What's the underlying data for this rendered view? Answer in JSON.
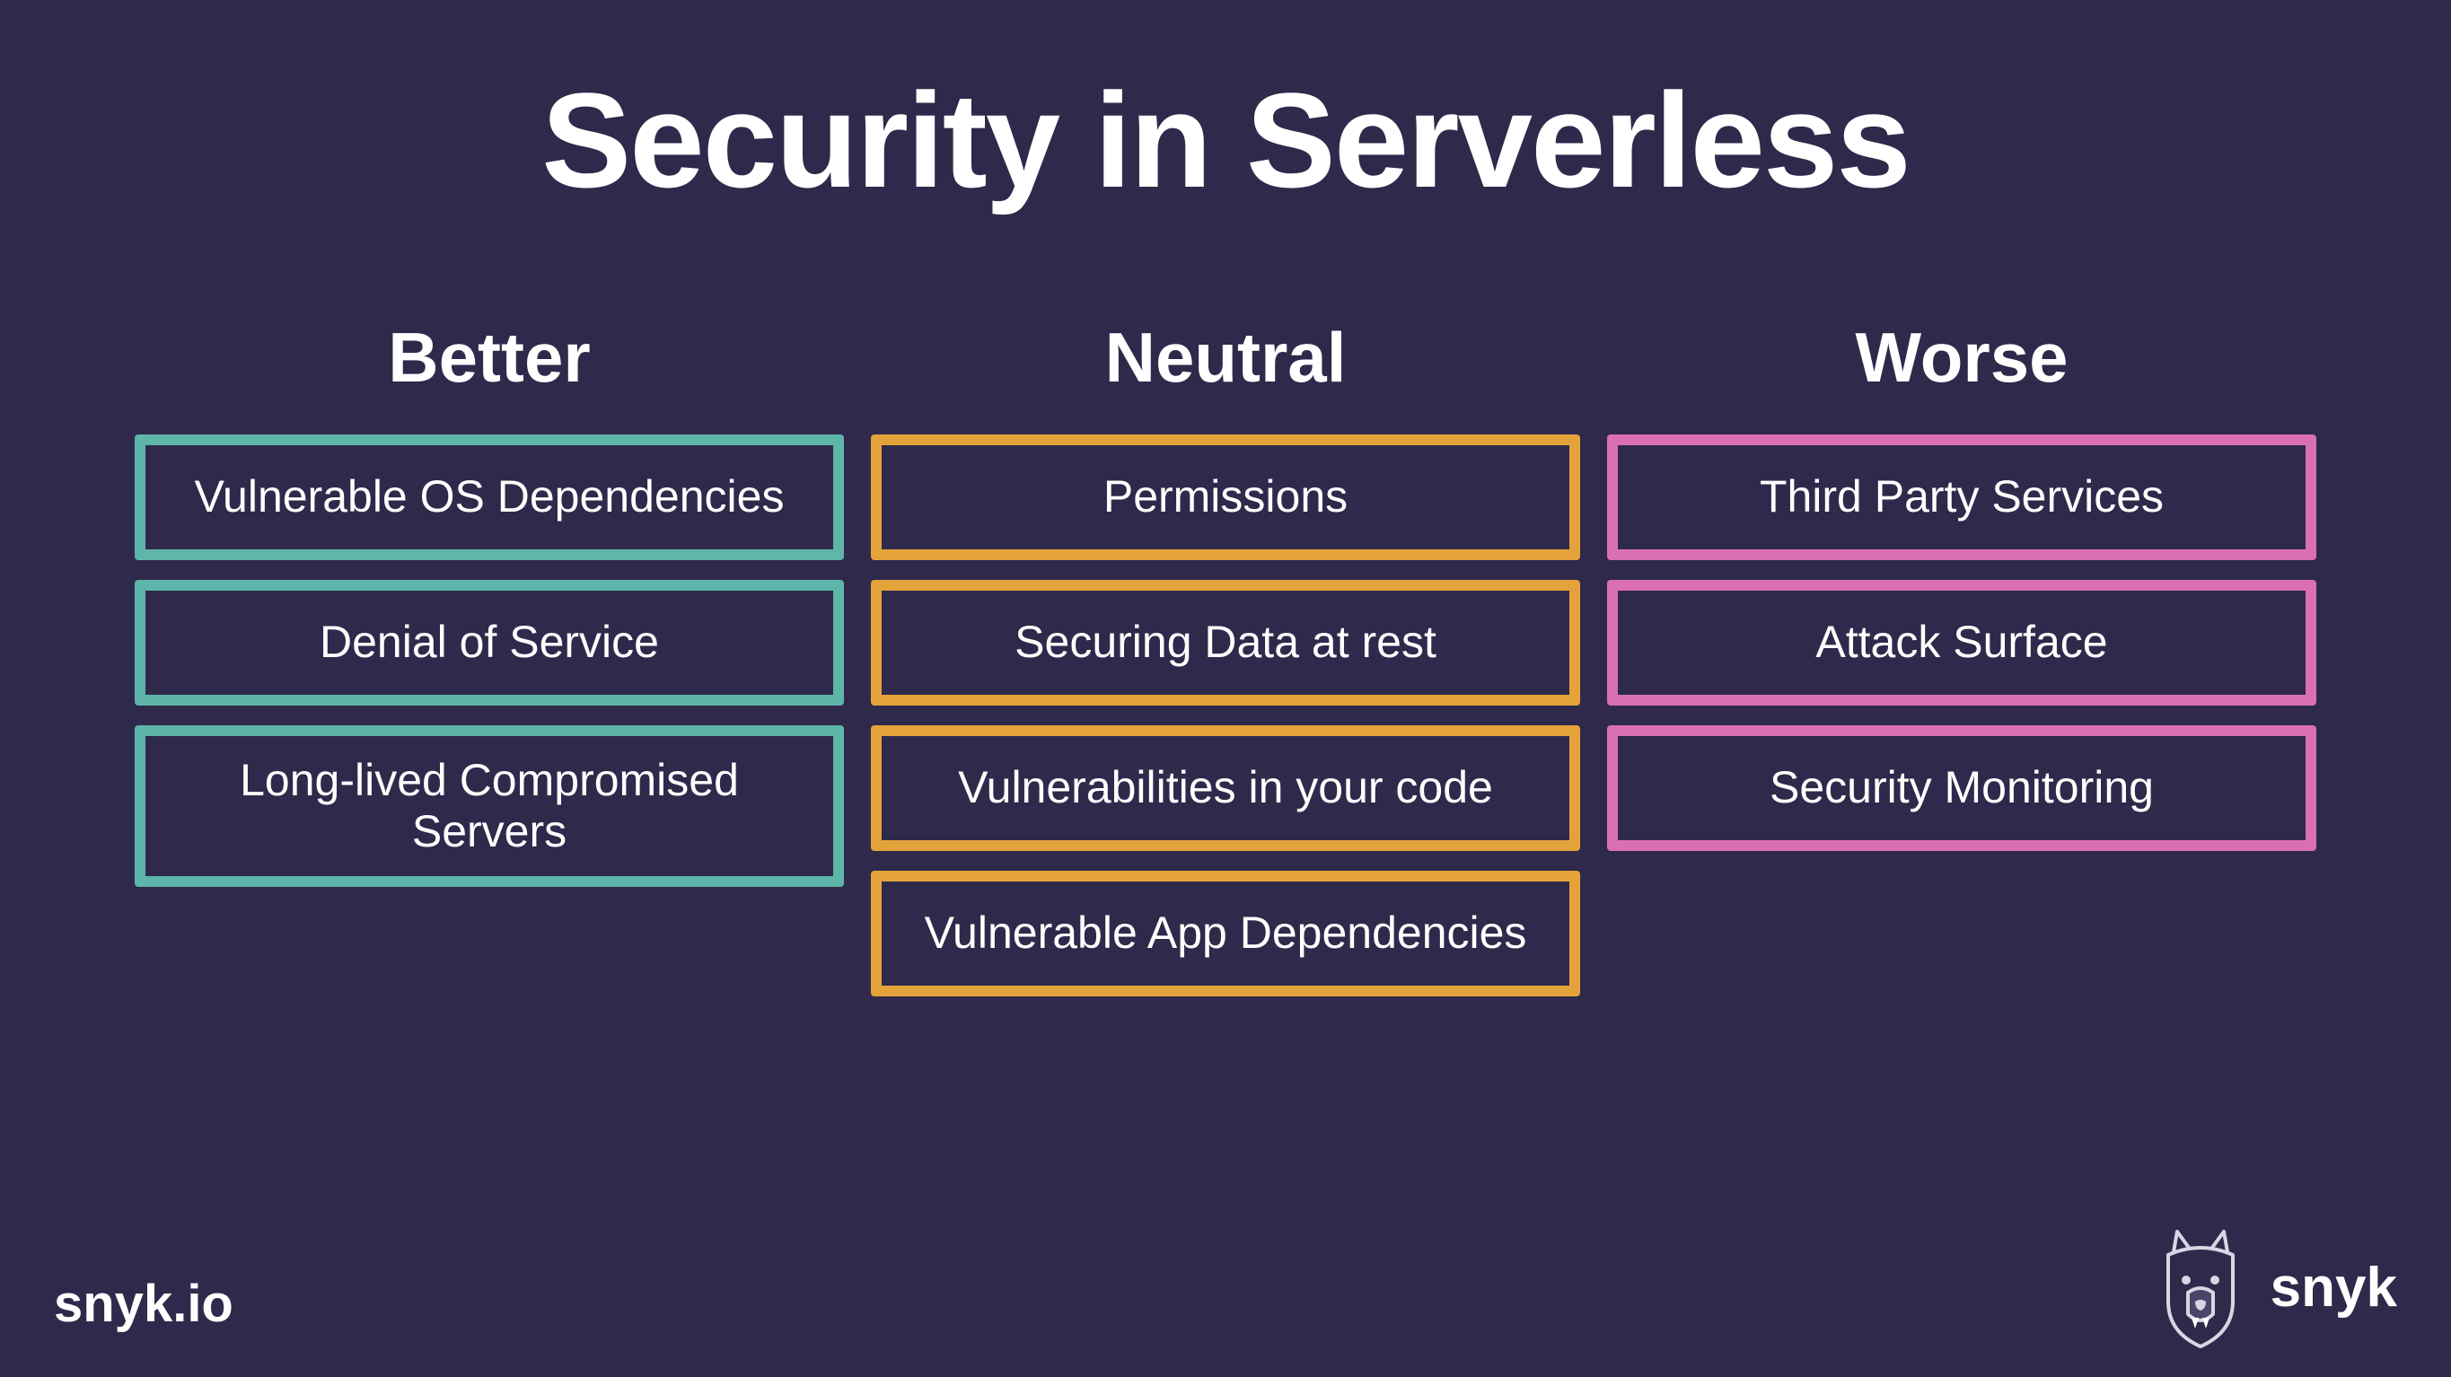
{
  "title": "Security in Serverless",
  "columns": {
    "better": {
      "heading": "Better",
      "color": "teal",
      "items": [
        "Vulnerable OS Dependencies",
        "Denial of Service",
        "Long-lived Compromised Servers"
      ]
    },
    "neutral": {
      "heading": "Neutral",
      "color": "orange",
      "items": [
        "Permissions",
        "Securing Data at rest",
        "Vulnerabilities in your code",
        "Vulnerable App Dependencies"
      ]
    },
    "worse": {
      "heading": "Worse",
      "color": "pink",
      "items": [
        "Third Party Services",
        "Attack Surface",
        "Security Monitoring"
      ]
    }
  },
  "footer": {
    "site": "snyk.io",
    "brand": "snyk"
  },
  "colors": {
    "background": "#2f2a4b",
    "teal": "#5fb4a8",
    "orange": "#e2a23b",
    "pink": "#d96fb5",
    "text": "#ffffff"
  }
}
